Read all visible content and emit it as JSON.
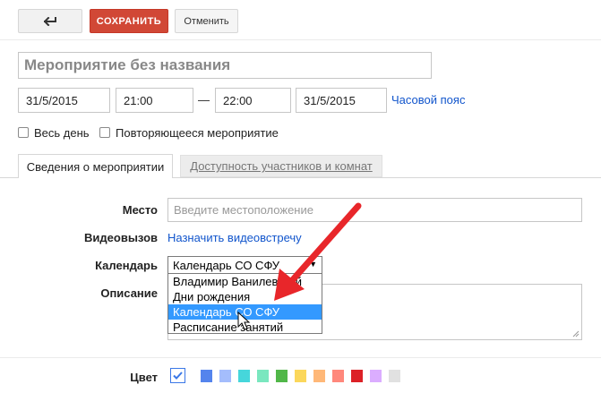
{
  "toolbar": {
    "back_icon": "back-arrow-icon",
    "save_label": "СОХРАНИТЬ",
    "cancel_label": "Отменить"
  },
  "event": {
    "title": "Мероприятие без названия",
    "start_date": "31/5/2015",
    "start_time": "21:00",
    "dash": "—",
    "end_time": "22:00",
    "end_date": "31/5/2015",
    "timezone_link": "Часовой пояс",
    "all_day_label": "Весь день",
    "repeat_label": "Повторяющееся мероприятие"
  },
  "tabs": [
    {
      "label": "Сведения о мероприятии",
      "active": true
    },
    {
      "label": "Доступность участников и комнат",
      "active": false
    }
  ],
  "details": {
    "location_label": "Место",
    "location_placeholder": "Введите местоположение",
    "video_label": "Видеовызов",
    "video_link": "Назначить видеовстречу",
    "calendar_label": "Календарь",
    "calendar_selected": "Календарь СО СФУ",
    "calendar_options": [
      "Владимир Ванилевский",
      "Дни рождения",
      "Календарь СО СФУ",
      "Расписание занятий"
    ],
    "calendar_highlighted_index": 2,
    "description_label": "Описание",
    "color_label": "Цвет"
  },
  "colors": {
    "accent": "#3b78e7",
    "save_button": "#d14836",
    "annotation_arrow": "#e8262a",
    "swatches": [
      "#5484ed",
      "#a4bdfc",
      "#46d6db",
      "#7ae7bf",
      "#51b749",
      "#fbd75b",
      "#ffb878",
      "#ff887c",
      "#dc2127",
      "#dbadff",
      "#e1e1e1"
    ]
  }
}
